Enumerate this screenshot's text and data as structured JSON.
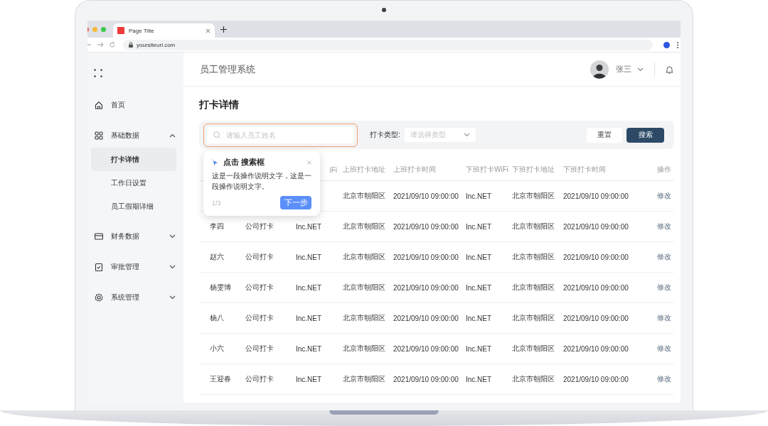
{
  "browser": {
    "tab_title": "Page Title",
    "url": "yoursiteurl.com"
  },
  "sidebar": {
    "items": [
      {
        "label": "首页",
        "selected": false
      },
      {
        "label": "基础数据",
        "selected": false,
        "expanded": true,
        "children": [
          {
            "label": "打卡详情",
            "selected": true
          },
          {
            "label": "工作日设置",
            "selected": false
          },
          {
            "label": "员工假期详细",
            "selected": false
          }
        ]
      },
      {
        "label": "财务数据",
        "selected": false,
        "expanded": false
      },
      {
        "label": "审批管理",
        "selected": false,
        "expanded": false
      },
      {
        "label": "系统管理",
        "selected": false,
        "expanded": false
      }
    ]
  },
  "header": {
    "app_title": "员工管理系统",
    "user_name": "张三"
  },
  "page_title": "打卡详情",
  "filters": {
    "search": {
      "placeholder": "请输入员工姓名",
      "highlighted": true
    },
    "type_label": "打卡类型:",
    "type_select": {
      "placeholder": "请选择类型"
    },
    "buttons": [
      {
        "label": "重置",
        "kind": "secondary"
      },
      {
        "label": "搜索",
        "kind": "primary"
      }
    ]
  },
  "table": {
    "columns": [
      "",
      "",
      "iFi",
      "上班打卡地址",
      "上班打卡时间",
      "下班打卡WiFi",
      "下班打卡地址",
      "下班打卡时间",
      "操作"
    ],
    "rows": [
      [
        "",
        "",
        "",
        "北京市朝阳区",
        "2021/09/10 09:00:00",
        "Inc.NET",
        "北京市朝阳区",
        "2021/09/10 09:00:00",
        "修改"
      ],
      [
        "李四",
        "公司打卡",
        "Inc.NET",
        "北京市朝阳区",
        "2021/09/10 09:00:00",
        "Inc.NET",
        "北京市朝阳区",
        "2021/09/10 09:00:00",
        "修改"
      ],
      [
        "赵六",
        "公司打卡",
        "Inc.NET",
        "北京市朝阳区",
        "2021/09/10 09:00:00",
        "Inc.NET",
        "北京市朝阳区",
        "2021/09/10 09:00:00",
        "修改"
      ],
      [
        "杨雯博",
        "公司打卡",
        "Inc.NET",
        "北京市朝阳区",
        "2021/09/10 09:00:00",
        "Inc.NET",
        "北京市朝阳区",
        "2021/09/10 09:00:00",
        "修改"
      ],
      [
        "杨八",
        "公司打卡",
        "Inc.NET",
        "北京市朝阳区",
        "2021/09/10 09:00:00",
        "Inc.NET",
        "北京市朝阳区",
        "2021/09/10 09:00:00",
        "修改"
      ],
      [
        "小六",
        "公司打卡",
        "Inc.NET",
        "北京市朝阳区",
        "2021/09/10 09:00:00",
        "Inc.NET",
        "北京市朝阳区",
        "2021/09/10 09:00:00",
        "修改"
      ],
      [
        "王迎春",
        "公司打卡",
        "Inc.NET",
        "北京市朝阳区",
        "2021/09/10 09:00:00",
        "Inc.NET",
        "北京市朝阳区",
        "2021/09/10 09:00:00",
        "修改"
      ]
    ]
  },
  "guide_popover": {
    "title": "点击 搜索框",
    "text": "这是一段操作说明文字，这是一段操作说明文字。",
    "step": "1/3",
    "button": "下一步"
  }
}
